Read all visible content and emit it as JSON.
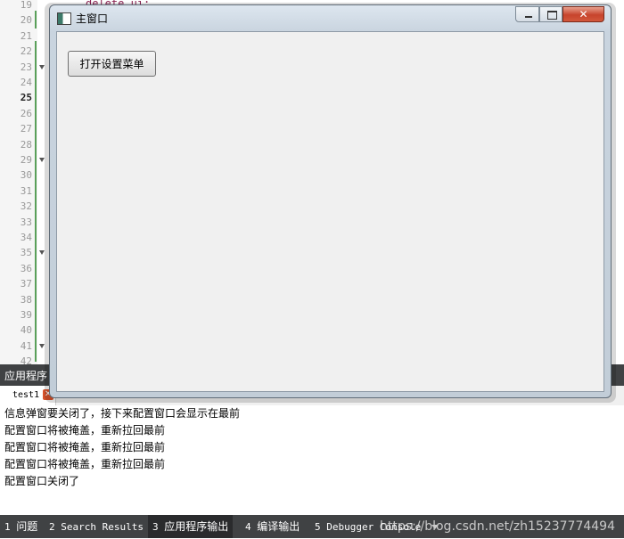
{
  "editor": {
    "code_peek": "delete ui;",
    "line_numbers": [
      "19",
      "20",
      "21",
      "22",
      "23",
      "24",
      "25",
      "26",
      "27",
      "28",
      "29",
      "30",
      "31",
      "32",
      "33",
      "34",
      "35",
      "36",
      "37",
      "38",
      "39",
      "40",
      "41",
      "42"
    ],
    "current_line": "25",
    "fold_lines": [
      "23",
      "29",
      "35",
      "41"
    ]
  },
  "window": {
    "title": "主窗口",
    "open_settings_button": "打开设置菜单",
    "close_glyph": "✕"
  },
  "panel": {
    "title": "应用程序",
    "tab_label": "test1",
    "tab_close": "✕",
    "output_lines": [
      "信息弹窗要关闭了，接下来配置窗口会显示在最前",
      "配置窗口将被掩盖，重新拉回最前",
      "配置窗口将被掩盖，重新拉回最前",
      "配置窗口将被掩盖，重新拉回最前",
      "配置窗口关闭了"
    ]
  },
  "statusbar": {
    "items": [
      {
        "num": "1",
        "label": "问题"
      },
      {
        "num": "2",
        "label": "Search Results"
      },
      {
        "num": "3",
        "label": "应用程序输出"
      },
      {
        "num": "4",
        "label": "编译输出"
      },
      {
        "num": "5",
        "label": "Debugger Console"
      }
    ],
    "watermark": "https://blog.csdn.net/zh15237774494"
  }
}
